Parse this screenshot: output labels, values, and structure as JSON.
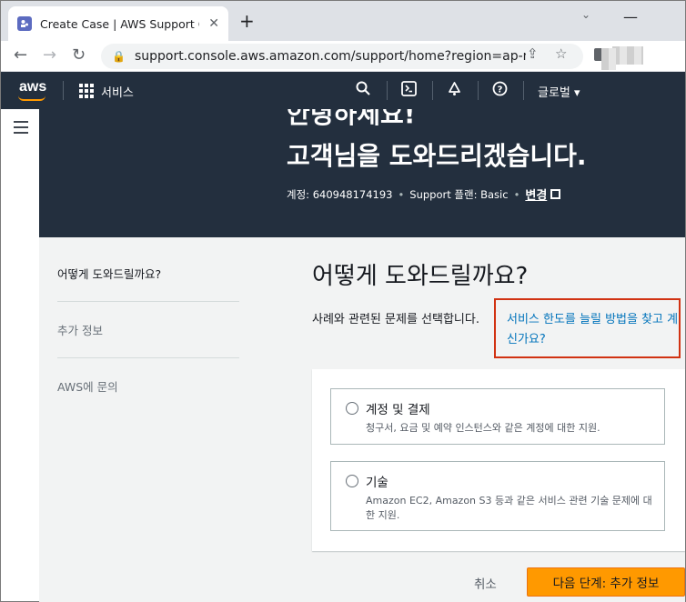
{
  "browser": {
    "tab_title": "Create Case | AWS Support Con",
    "url": "support.console.aws.amazon.com/support/home?region=ap-nor..."
  },
  "aws_nav": {
    "logo": "aws",
    "services_label": "서비스",
    "region_label": "글로벌 ▾"
  },
  "hero": {
    "greeting": "안녕하세요!",
    "title": "고객님을 도와드리겠습니다.",
    "account": "계정: 640948174193",
    "plan": "Support 플랜: Basic",
    "change_label": "변경"
  },
  "steps": [
    {
      "label": "어떻게 도와드릴까요?"
    },
    {
      "label": "추가 정보"
    },
    {
      "label": "AWS에 문의"
    }
  ],
  "main": {
    "title": "어떻게 도와드릴까요?",
    "description": "사례와 관련된 문제를 선택합니다.",
    "help_link": "서비스 한도를 늘릴 방법을 찾고 계신가요?",
    "options": [
      {
        "title": "계정 및 결제",
        "description": "청구서, 요금 및 예약 인스턴스와 같은 계정에 대한 지원."
      },
      {
        "title": "기술",
        "description": "Amazon EC2, Amazon S3 등과 같은 서비스 관련 기술 문제에 대한 지원."
      }
    ],
    "cancel_label": "취소",
    "next_label": "다음 단계: 추가 정보"
  }
}
